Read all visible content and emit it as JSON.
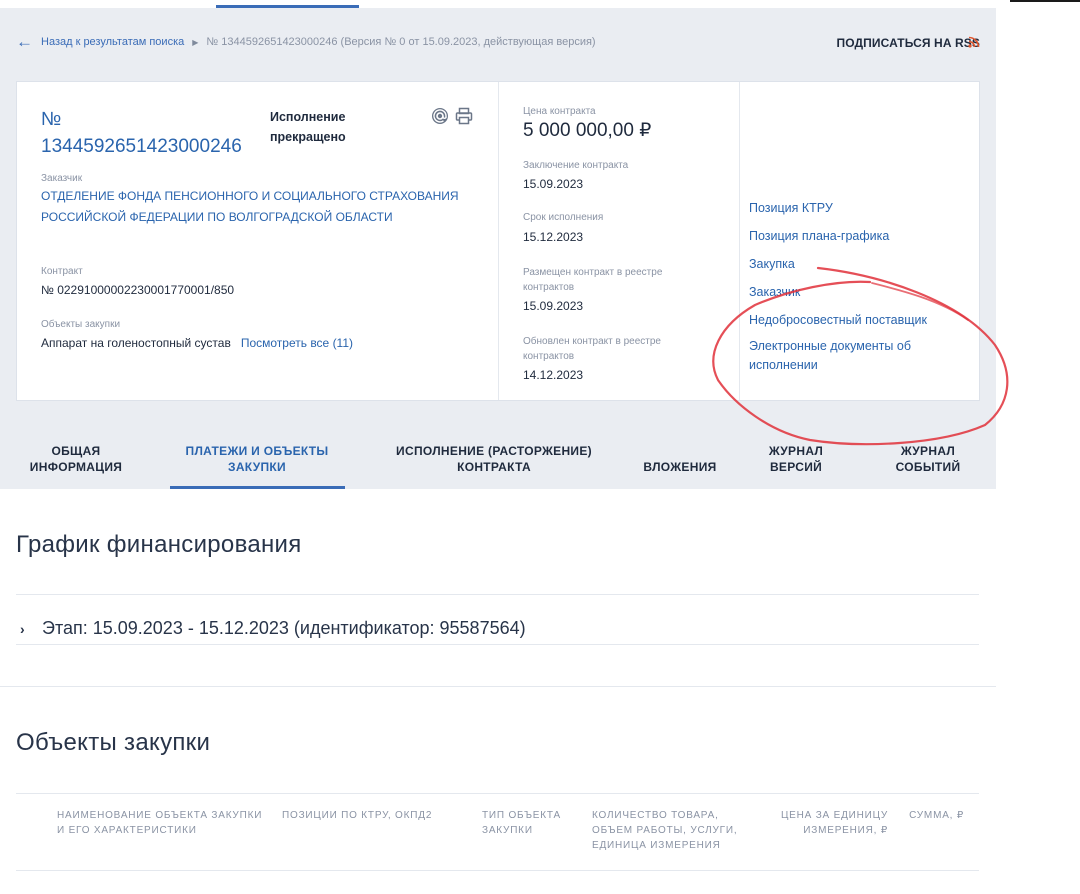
{
  "breadcrumb": {
    "back_label": "Назад к результатам поиска",
    "current": "№ 1344592651423000246 (Версия № 0 от 15.09.2023, действующая версия)"
  },
  "rss": {
    "label": "ПОДПИСАТЬСЯ НА RSS",
    "color": "#e0552c"
  },
  "contract": {
    "number": "№ 1344592651423000246",
    "status": "Исполнение прекращено",
    "customer_label": "Заказчик",
    "customer_name": "ОТДЕЛЕНИЕ ФОНДА ПЕНСИОННОГО И СОЦИАЛЬНОГО СТРАХОВАНИЯ РОССИЙСКОЙ ФЕДЕРАЦИИ ПО ВОЛГОГРАДСКОЙ ОБЛАСТИ",
    "contract_label": "Контракт",
    "contract_value": "№ 0229100000223000177000​1/850",
    "objects_label": "Объекты закупки",
    "objects_value": "Аппарат на голеностопный сустав",
    "objects_link": "Посмотреть все (11)"
  },
  "details": {
    "price_label": "Цена контракта",
    "price_value": "5 000 000,00 ₽",
    "conclusion_label": "Заключение контракта",
    "conclusion_value": "15.09.2023",
    "term_label": "Срок исполнения",
    "term_value": "15.12.2023",
    "placed_label": "Размещен контракт в реестре контрактов",
    "placed_value": "15.09.2023",
    "updated_label": "Обновлен контракт в реестре контрактов",
    "updated_value": "14.12.2023"
  },
  "links": [
    "Позиция КТРУ",
    "Позиция плана-графика",
    "Закупка",
    "Заказчик",
    "Недобросовестный поставщик",
    "Электронные документы об исполнении"
  ],
  "tabs": [
    "ОБЩАЯ ИНФОРМАЦИЯ",
    "ПЛАТЕЖИ И ОБЪЕКТЫ ЗАКУПКИ",
    "ИСПОЛНЕНИЕ (РАСТОРЖЕНИЕ) КОНТРАКТА",
    "ВЛОЖЕНИЯ",
    "ЖУРНАЛ ВЕРСИЙ",
    "ЖУРНАЛ СОБЫТИЙ"
  ],
  "financing": {
    "title": "График финансирования",
    "stage": "Этап: 15.09.2023 - 15.12.2023 (идентификатор: 95587564)"
  },
  "objects": {
    "title": "Объекты закупки",
    "columns": [
      "Наименование объекта закупки и его характеристики",
      "Позиции по КТРУ, ОКПД2",
      "Тип объекта закупки",
      "Количество товара, объем работы, услуги, единица измерения",
      "Цена за единицу измерения, ₽",
      "Сумма, ₽"
    ]
  },
  "colors": {
    "accent": "#2a64ad",
    "annotation": "#e0303a"
  }
}
